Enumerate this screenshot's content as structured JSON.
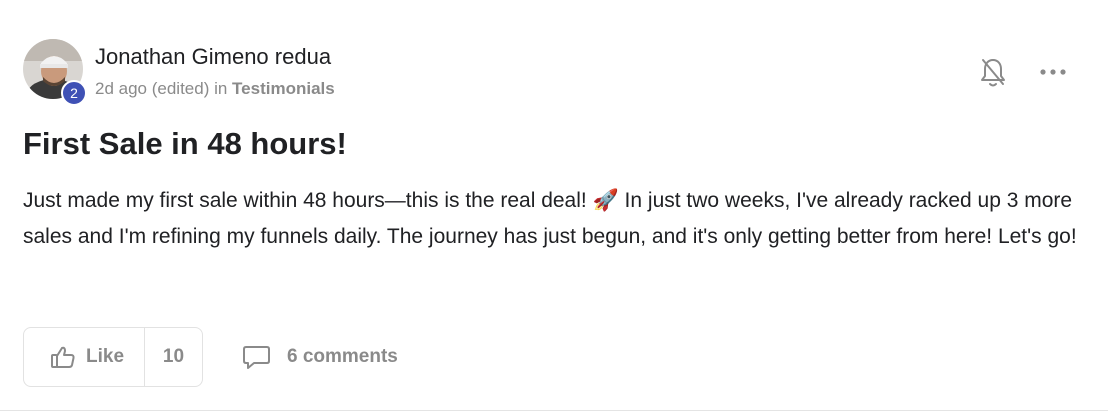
{
  "author": {
    "name": "Jonathan Gimeno redua",
    "level": "2"
  },
  "meta": {
    "time": "2d ago (edited) in ",
    "category": "Testimonials"
  },
  "post": {
    "title": "First Sale in 48 hours!",
    "body": "Just made my first sale within 48 hours—this is the real deal! 🚀 In just two weeks, I've already racked up 3 more sales and I'm refining my funnels daily. The journey has just begun, and it's only getting better from here! Let's go!"
  },
  "actions": {
    "like_label": "Like",
    "like_count": "10",
    "comments_label": "6 comments"
  },
  "icons": {
    "bell": "bell-off-icon",
    "more": "more-horizontal-icon",
    "like": "thumbs-up-icon",
    "comment": "comment-bubble-icon"
  },
  "colors": {
    "badge": "#3f51b5",
    "muted": "#8a8a8a",
    "text": "#202124"
  }
}
